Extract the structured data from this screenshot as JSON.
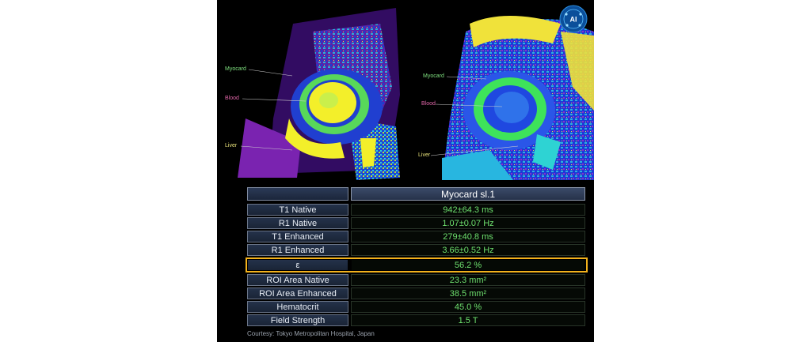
{
  "image_labels": {
    "left": {
      "myocard": "Myocard",
      "blood": "Blood",
      "liver": "Liver"
    },
    "right": {
      "myocard": "Myocard",
      "blood": "Blood",
      "liver": "Liver"
    }
  },
  "logo": {
    "icon": "molecule-badge-icon",
    "text": "AI"
  },
  "table": {
    "header": "Myocard sl.1",
    "rows": [
      {
        "label": "T1 Native",
        "value": "942±64.3 ms"
      },
      {
        "label": "R1 Native",
        "value": "1.07±0.07 Hz"
      },
      {
        "label": "T1 Enhanced",
        "value": "279±40.8 ms"
      },
      {
        "label": "R1 Enhanced",
        "value": "3.66±0.52 Hz"
      },
      {
        "label": "ε",
        "value": "56.2 %",
        "highlight_color": "#f3b21c"
      },
      {
        "label": "ROI Area Native",
        "value": "23.3 mm²"
      },
      {
        "label": "ROI Area Enhanced",
        "value": "38.5 mm²"
      },
      {
        "label": "Hematocrit",
        "value": "45.0 %"
      },
      {
        "label": "Field Strength",
        "value": "1.5 T"
      }
    ]
  },
  "credit": "Courtesy: Tokyo Metropolitan Hospital, Japan",
  "colors": {
    "value_text": "#6ee06e",
    "label_background": "#1f2b40",
    "highlight": "#f3b21c"
  }
}
